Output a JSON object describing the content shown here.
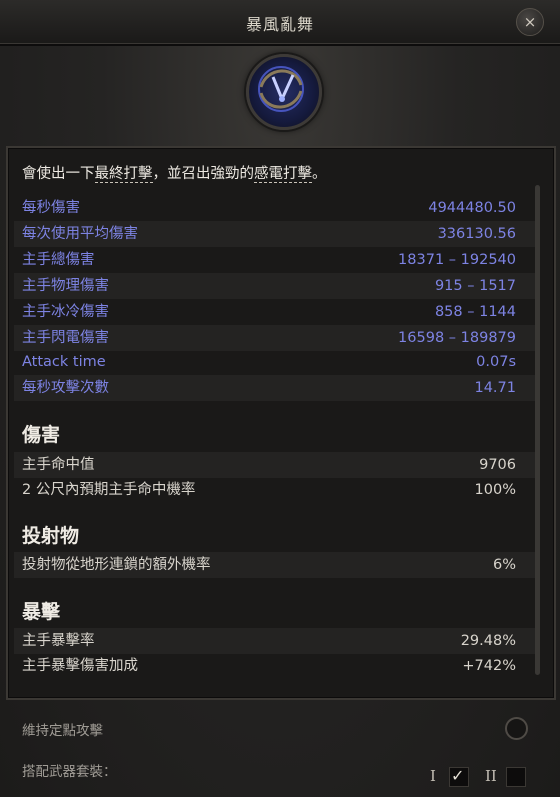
{
  "window": {
    "title": "暴風亂舞",
    "close_label": "×"
  },
  "emblem": {
    "icon": "lightning-spiral-skill-icon",
    "accent": "#2a3aa8"
  },
  "description": {
    "prefix": "會使出一下",
    "highlight1": "最終打擊",
    "middle": "，並召出強勁的",
    "highlight2": "感電打擊",
    "suffix": "。"
  },
  "stats": [
    {
      "label": "每秒傷害",
      "value": "4944480.50"
    },
    {
      "label": "每次使用平均傷害",
      "value": "336130.56"
    },
    {
      "label": "主手總傷害",
      "value": "18371 – 192540"
    },
    {
      "label": "主手物理傷害",
      "value": "915 – 1517"
    },
    {
      "label": "主手冰冷傷害",
      "value": "858 – 1144"
    },
    {
      "label": "主手閃電傷害",
      "value": "16598 – 189879"
    },
    {
      "label": "Attack time",
      "value": "0.07s"
    },
    {
      "label": "每秒攻擊次數",
      "value": "14.71"
    }
  ],
  "sections": {
    "damage": {
      "title": "傷害",
      "rows": [
        {
          "label": "主手命中值",
          "value": "9706"
        },
        {
          "label": "2 公尺內預期主手命中機率",
          "value": "100%"
        }
      ]
    },
    "projectile": {
      "title": "投射物",
      "rows": [
        {
          "label": "投射物從地形連鎖的額外機率",
          "value": "6%"
        }
      ]
    },
    "critical": {
      "title": "暴擊",
      "rows": [
        {
          "label": "主手暴擊率",
          "value": "29.48%"
        },
        {
          "label": "主手暴擊傷害加成",
          "value": "+742%"
        }
      ]
    }
  },
  "footer": {
    "hold_label": "維持定點攻擊",
    "weapon_set_label": "搭配武器套裝：",
    "set1_label": "I",
    "set2_label": "II",
    "set1_checked": true,
    "set2_checked": false
  },
  "colors": {
    "stat_blue": "#7d83e3",
    "text_light": "#d8d4cc"
  }
}
